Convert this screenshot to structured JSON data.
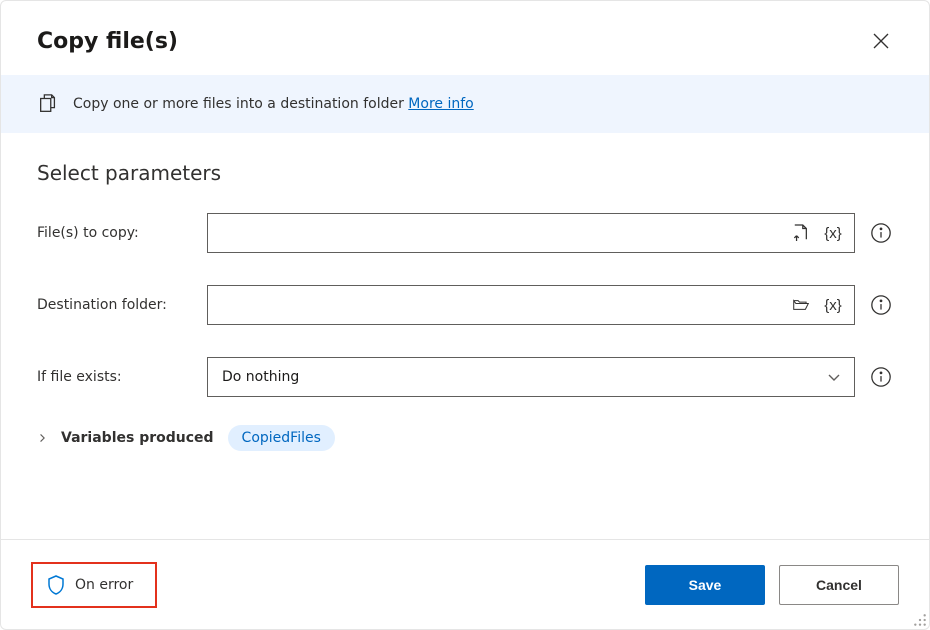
{
  "dialog": {
    "title": "Copy file(s)"
  },
  "banner": {
    "text": "Copy one or more files into a destination folder ",
    "link": "More info"
  },
  "section": {
    "title": "Select parameters"
  },
  "fields": {
    "files_label": "File(s) to copy:",
    "files_value": "",
    "dest_label": "Destination folder:",
    "dest_value": "",
    "ifexists_label": "If file exists:",
    "ifexists_value": "Do nothing"
  },
  "variables": {
    "label": "Variables produced",
    "chip": "CopiedFiles"
  },
  "footer": {
    "on_error": "On error",
    "save": "Save",
    "cancel": "Cancel"
  }
}
